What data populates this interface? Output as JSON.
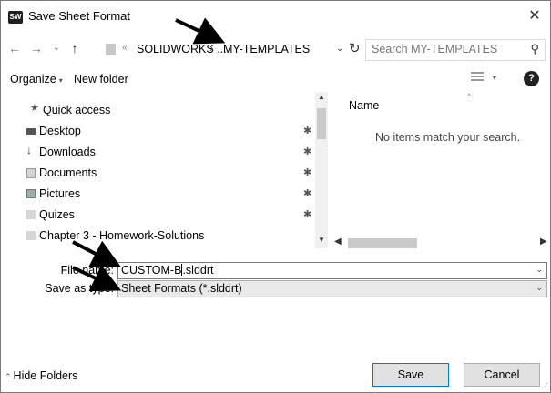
{
  "window": {
    "title": "Save Sheet Format",
    "icon": "solidworks-app-icon",
    "close": "✕"
  },
  "navbar": {
    "back": "←",
    "forward": "→",
    "recent_dropdown": "⌄",
    "up": "↑",
    "overflow": "«",
    "breadcrumbs": [
      "SOLIDWORKS ...",
      "MY-TEMPLATES"
    ],
    "separator": "›",
    "address_dropdown": "⌄",
    "refresh": "↻",
    "search_placeholder": "Search MY-TEMPLATES",
    "search_icon": "⚲"
  },
  "toolbar": {
    "organize": "Organize",
    "organize_caret": "▾",
    "new_folder": "New folder",
    "view_caret": "▾",
    "help": "?"
  },
  "sidebar": {
    "items": [
      {
        "label": "Quick access",
        "icon": "star-icon",
        "glyph": "★",
        "pinned": false
      },
      {
        "label": "Desktop",
        "icon": "desktop-folder-icon",
        "glyph": "",
        "pinned": true
      },
      {
        "label": "Downloads",
        "icon": "downloads-icon",
        "glyph": "↓",
        "pinned": true
      },
      {
        "label": "Documents",
        "icon": "documents-icon",
        "glyph": "",
        "pinned": true
      },
      {
        "label": "Pictures",
        "icon": "pictures-icon",
        "glyph": "",
        "pinned": true
      },
      {
        "label": "Quizes",
        "icon": "folder-icon",
        "glyph": "",
        "pinned": true
      },
      {
        "label": "Chapter 3 - Homework-Solutions",
        "icon": "folder-icon",
        "glyph": "",
        "pinned": false
      }
    ],
    "pin_glyph": "✱"
  },
  "scroll": {
    "up": "▲",
    "down": "▼",
    "left": "◀",
    "right": "▶"
  },
  "content": {
    "column_name": "Name",
    "sort_indicator": "^",
    "empty_message": "No items match your search."
  },
  "form": {
    "file_name_label": "File name:",
    "file_name_before_cursor": "CUSTOM-B",
    "file_name_after_cursor": ".slddrt",
    "save_as_type_label": "Save as type:",
    "save_as_type_value": "Sheet Formats (*.slddrt)",
    "dropdown_caret": "⌄"
  },
  "footer": {
    "hide_folders": "Hide Folders",
    "hide_chevron": "⌃",
    "save": "Save",
    "cancel": "Cancel"
  },
  "colors": {
    "annotation_arrow": "#000000",
    "save_border": "#0078d7"
  }
}
